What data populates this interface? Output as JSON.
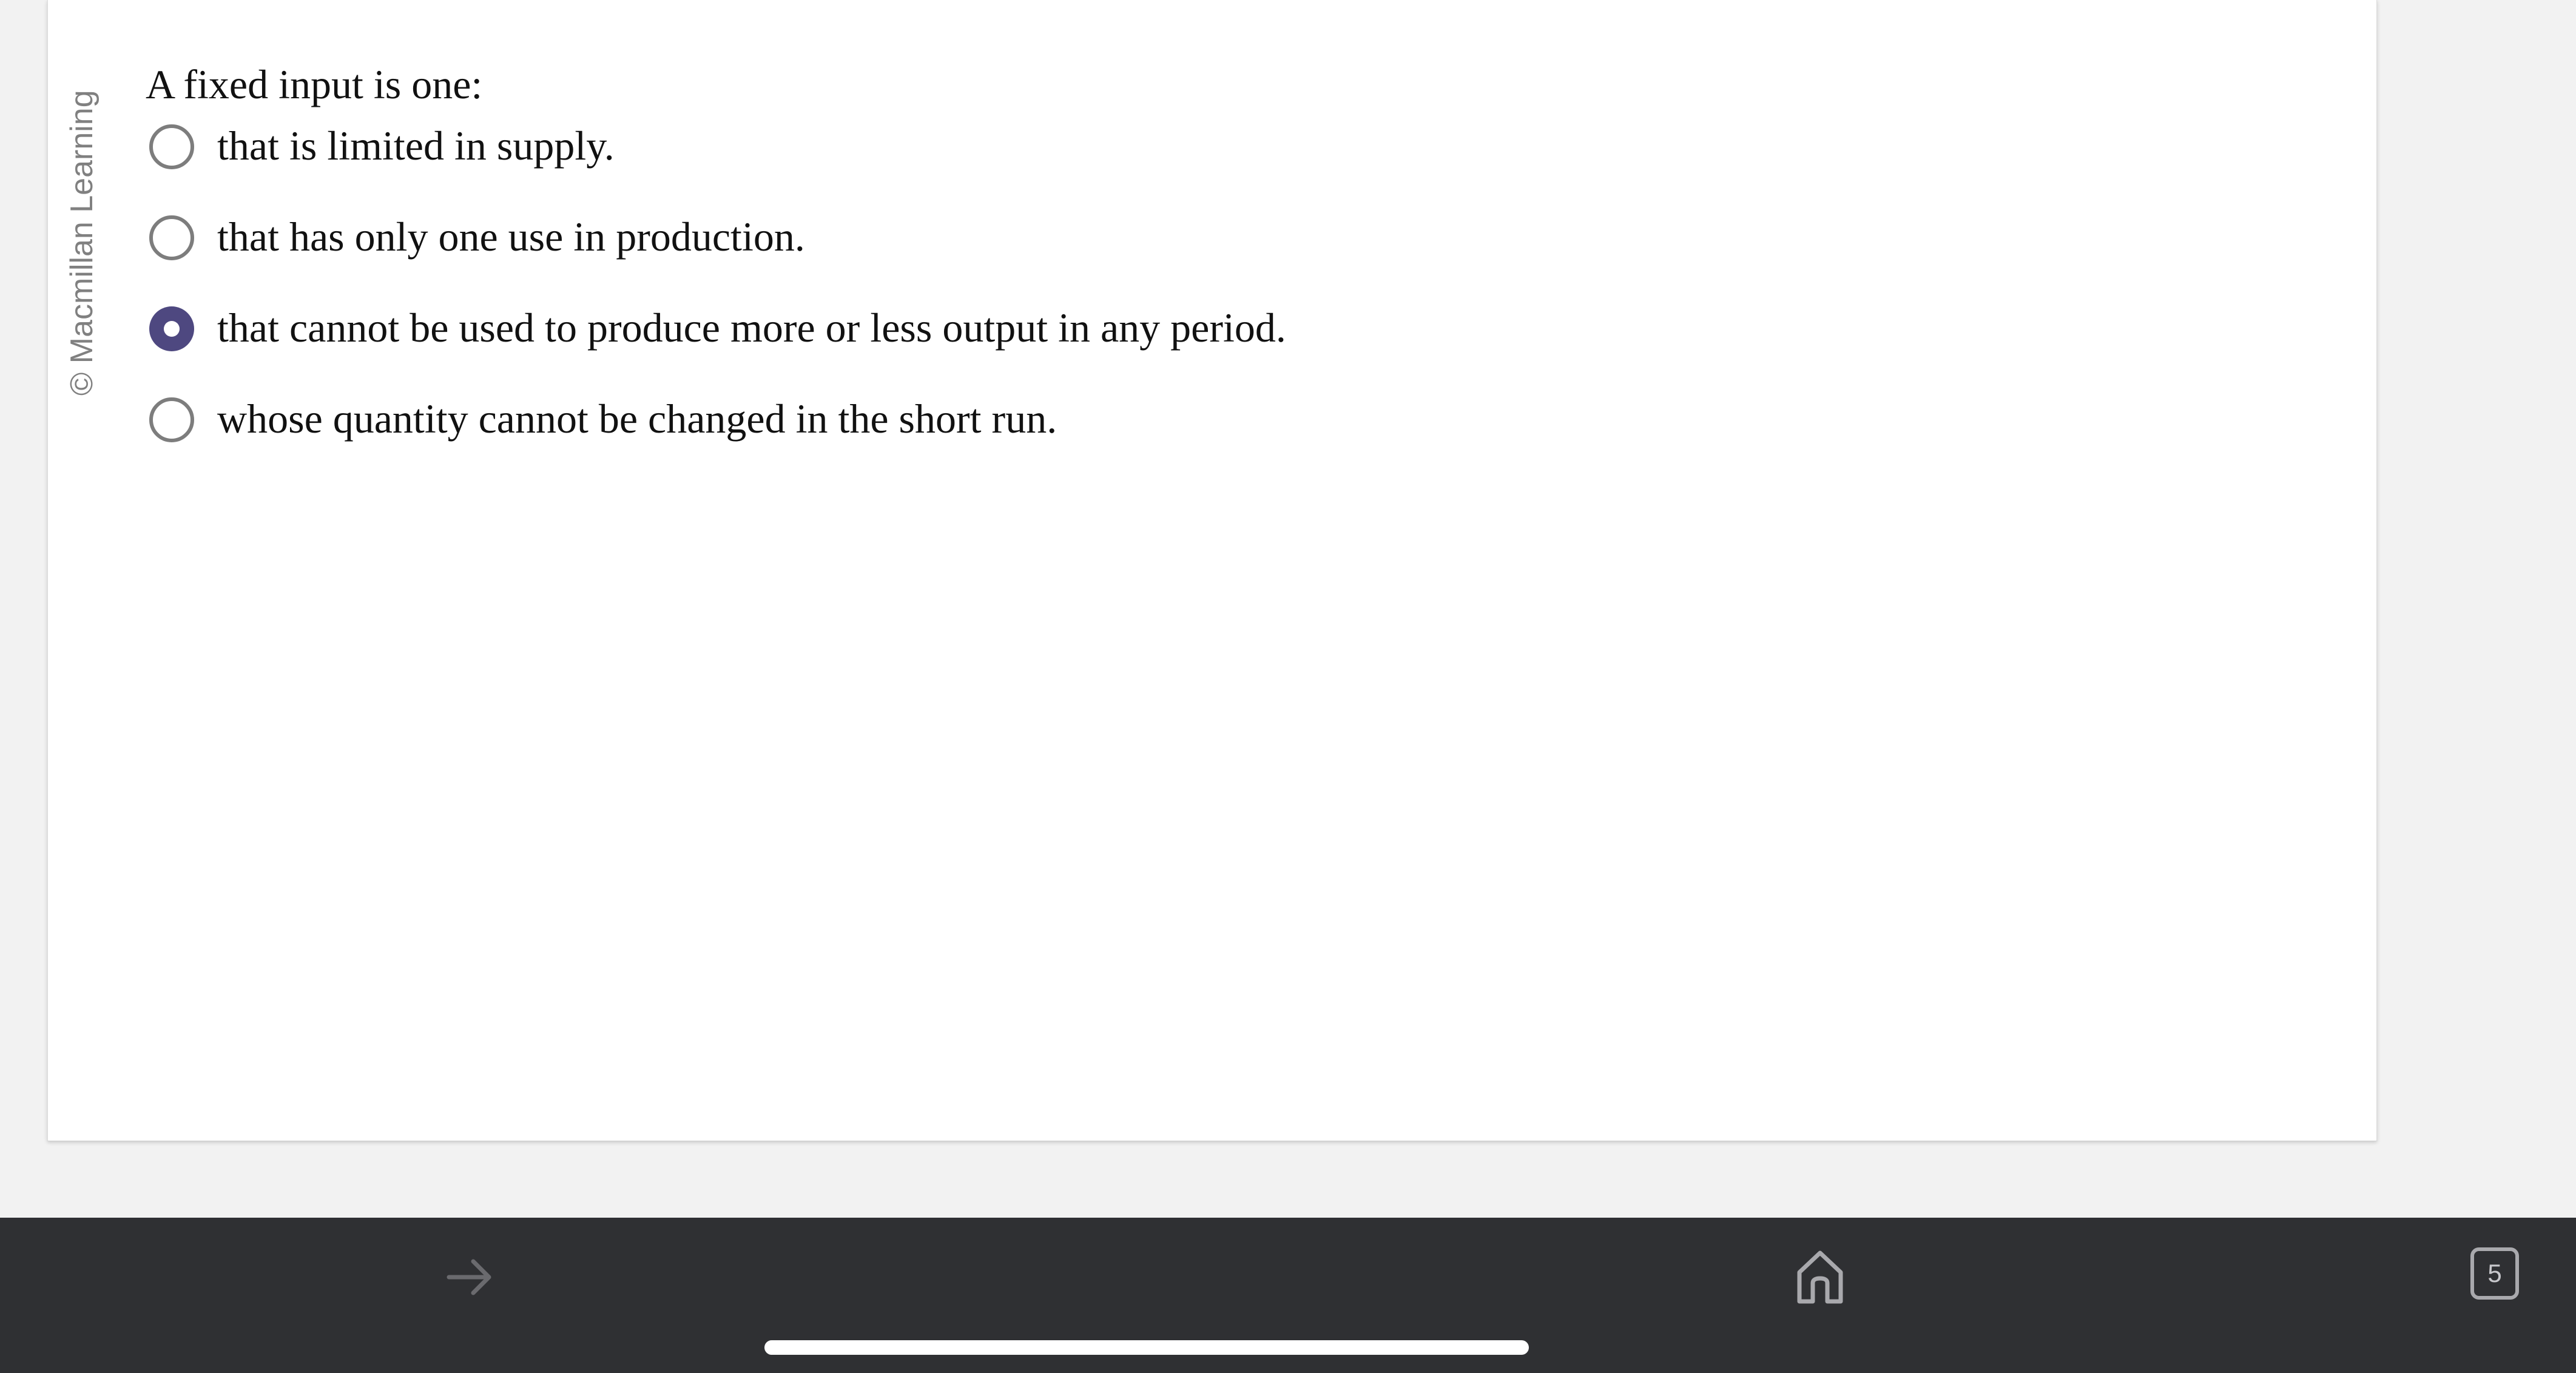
{
  "watermark": {
    "copyright": "© Macmillan Learning"
  },
  "question": {
    "prompt": "A fixed input is one:",
    "options": [
      {
        "label": "that is limited in supply.",
        "selected": false
      },
      {
        "label": "that has only one use in production.",
        "selected": false
      },
      {
        "label": "that cannot be used to produce more or less output in any period.",
        "selected": true
      },
      {
        "label": "whose quantity cannot be changed in the short run.",
        "selected": false
      }
    ]
  },
  "browser_toolbar": {
    "forward_icon": "arrow-right-icon",
    "home_icon": "home-icon",
    "tab_count": "5"
  },
  "colors": {
    "selected_radio": "#4e4880",
    "toolbar_background": "#2f3033",
    "page_background": "#f2f2f2"
  }
}
